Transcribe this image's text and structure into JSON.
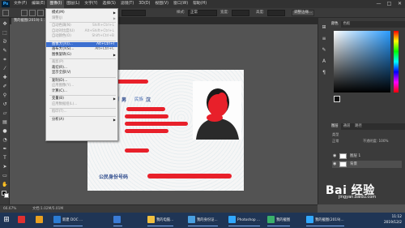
{
  "app": {
    "logo": "Ps"
  },
  "menubar": {
    "items": [
      "文件(F)",
      "编辑(E)",
      "图像(I)",
      "图层(L)",
      "文字(Y)",
      "选择(S)",
      "滤镜(T)",
      "3D(D)",
      "视图(V)",
      "窗口(W)",
      "帮助(H)"
    ],
    "active_index": 2
  },
  "window_controls": {
    "minimize": "—",
    "maximize": "□",
    "close": "✕"
  },
  "options_bar": {
    "field1_value": "",
    "style_label": "样式:",
    "style_value": "正常",
    "width_label": "宽度:",
    "height_label": "高度:",
    "refine_button": "调整边缘..."
  },
  "document_tab": {
    "title": "我的截图(2019)-1 ...",
    "close": "×"
  },
  "image_menu": {
    "items": [
      {
        "label": "模式(M)",
        "shortcut": "",
        "submenu": true,
        "disabled": false,
        "highlight": false
      },
      {
        "label": "调整(J)",
        "shortcut": "",
        "submenu": true,
        "disabled": true,
        "highlight": false
      },
      {
        "label": "自动色调(N)",
        "shortcut": "Shift+Ctrl+L",
        "submenu": false,
        "disabled": true,
        "highlight": false
      },
      {
        "label": "自动对比度(U)",
        "shortcut": "Alt+Shift+Ctrl+L",
        "submenu": false,
        "disabled": true,
        "highlight": false
      },
      {
        "label": "自动颜色(O)",
        "shortcut": "Shift+Ctrl+B",
        "submenu": false,
        "disabled": true,
        "highlight": false
      },
      {
        "label": "图像大小(I)...",
        "shortcut": "Alt+Ctrl+I",
        "submenu": false,
        "disabled": false,
        "highlight": true
      },
      {
        "label": "画布大小(S)...",
        "shortcut": "Alt+Ctrl+C",
        "submenu": false,
        "disabled": false,
        "highlight": false
      },
      {
        "label": "图像旋转(G)",
        "shortcut": "",
        "submenu": true,
        "disabled": false,
        "highlight": false
      },
      {
        "label": "裁剪(P)",
        "shortcut": "",
        "submenu": false,
        "disabled": true,
        "highlight": false
      },
      {
        "label": "裁切(R)...",
        "shortcut": "",
        "submenu": false,
        "disabled": false,
        "highlight": false
      },
      {
        "label": "显示全部(V)",
        "shortcut": "",
        "submenu": false,
        "disabled": false,
        "highlight": false
      },
      {
        "label": "复制(D)...",
        "shortcut": "",
        "submenu": false,
        "disabled": false,
        "highlight": false
      },
      {
        "label": "应用图像(Y)...",
        "shortcut": "",
        "submenu": false,
        "disabled": true,
        "highlight": false
      },
      {
        "label": "计算(C)...",
        "shortcut": "",
        "submenu": false,
        "disabled": false,
        "highlight": false
      },
      {
        "label": "变量(B)",
        "shortcut": "",
        "submenu": true,
        "disabled": false,
        "highlight": false
      },
      {
        "label": "应用数据组(L)...",
        "shortcut": "",
        "submenu": false,
        "disabled": true,
        "highlight": false
      },
      {
        "label": "陷印(T)...",
        "shortcut": "",
        "submenu": false,
        "disabled": true,
        "highlight": false
      },
      {
        "label": "分析(A)",
        "shortcut": "",
        "submenu": true,
        "disabled": false,
        "highlight": false
      }
    ]
  },
  "id_card": {
    "gender_label": "性别",
    "gender_value": "男",
    "ethnicity_label": "民族",
    "ethnicity_value": "汉",
    "id_label": "公民身份号码"
  },
  "panels": {
    "color_tabs": [
      "颜色",
      "色板"
    ],
    "layer_tabs": [
      "图层",
      "通道",
      "路径"
    ],
    "layer_filter": "类型",
    "layer_blend": "正常",
    "layer_opacity": "不透明度: 100%",
    "layers": [
      {
        "name": "图层 1",
        "selected": false
      },
      {
        "name": "背景",
        "selected": true
      }
    ]
  },
  "status": {
    "zoom": "66.67%",
    "doc": "文档:1.02M/5.01M"
  },
  "taskbar": {
    "apps": [
      {
        "label": "",
        "color": "#e03030"
      },
      {
        "label": "新建 DOC ...",
        "color": "#2b7cd3"
      },
      {
        "label": "",
        "color": "#3a7bd5"
      },
      {
        "label": "我的电脑...",
        "color": "#f0c040"
      },
      {
        "label": "我的身份证...",
        "color": "#4aa0e0"
      },
      {
        "label": "Photoshop ...",
        "color": "#31a8ff"
      },
      {
        "label": "我的截图",
        "color": "#3ab06a"
      },
      {
        "label": "我的截图(2019)...",
        "color": "#31a8ff"
      }
    ],
    "time": "11:12",
    "date": "2019/12/2"
  },
  "watermark": {
    "main": "Bai 经验",
    "sub": "jingyan.baidu.com"
  }
}
